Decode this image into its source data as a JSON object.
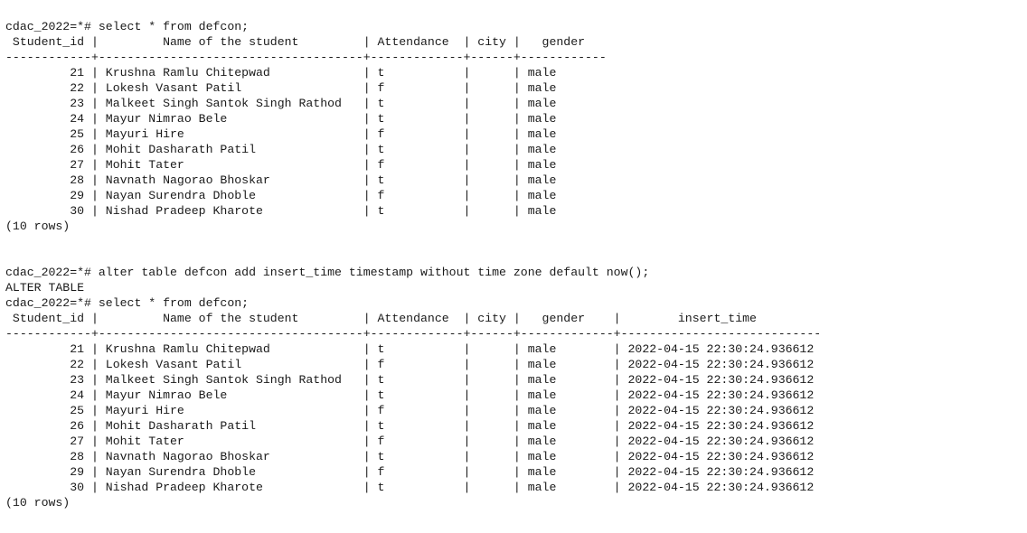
{
  "terminal": {
    "lines": [
      "cdac_2022=*# select * from defcon;",
      " Student_id |         Name of the student         | Attendance  | city |   gender",
      "------------+-------------------------------------+-------------+------+------------",
      "         21 | Krushna Ramlu Chitepwad             | t           |      | male",
      "         22 | Lokesh Vasant Patil                 | f           |      | male",
      "         23 | Malkeet Singh Santok Singh Rathod   | t           |      | male",
      "         24 | Mayur Nimrao Bele                   | t           |      | male",
      "         25 | Mayuri Hire                         | f           |      | male",
      "         26 | Mohit Dasharath Patil               | t           |      | male",
      "         27 | Mohit Tater                         | f           |      | male",
      "         28 | Navnath Nagorao Bhoskar             | t           |      | male",
      "         29 | Nayan Surendra Dhoble               | f           |      | male",
      "         30 | Nishad Pradeep Kharote              | t           |      | male",
      "(10 rows)",
      "",
      "",
      "cdac_2022=*# alter table defcon add insert_time timestamp without time zone default now();",
      "ALTER TABLE",
      "cdac_2022=*# select * from defcon;",
      " Student_id |         Name of the student         | Attendance  | city |   gender    |        insert_time",
      "------------+-------------------------------------+-------------+------+-------------+----------------------------",
      "         21 | Krushna Ramlu Chitepwad             | t           |      | male        | 2022-04-15 22:30:24.936612",
      "         22 | Lokesh Vasant Patil                 | f           |      | male        | 2022-04-15 22:30:24.936612",
      "         23 | Malkeet Singh Santok Singh Rathod   | t           |      | male        | 2022-04-15 22:30:24.936612",
      "         24 | Mayur Nimrao Bele                   | t           |      | male        | 2022-04-15 22:30:24.936612",
      "         25 | Mayuri Hire                         | f           |      | male        | 2022-04-15 22:30:24.936612",
      "         26 | Mohit Dasharath Patil               | t           |      | male        | 2022-04-15 22:30:24.936612",
      "         27 | Mohit Tater                         | f           |      | male        | 2022-04-15 22:30:24.936612",
      "         28 | Navnath Nagorao Bhoskar             | t           |      | male        | 2022-04-15 22:30:24.936612",
      "         29 | Nayan Surendra Dhoble               | f           |      | male        | 2022-04-15 22:30:24.936612",
      "         30 | Nishad Pradeep Kharote              | t           |      | male        | 2022-04-15 22:30:24.936612",
      "(10 rows)"
    ]
  }
}
